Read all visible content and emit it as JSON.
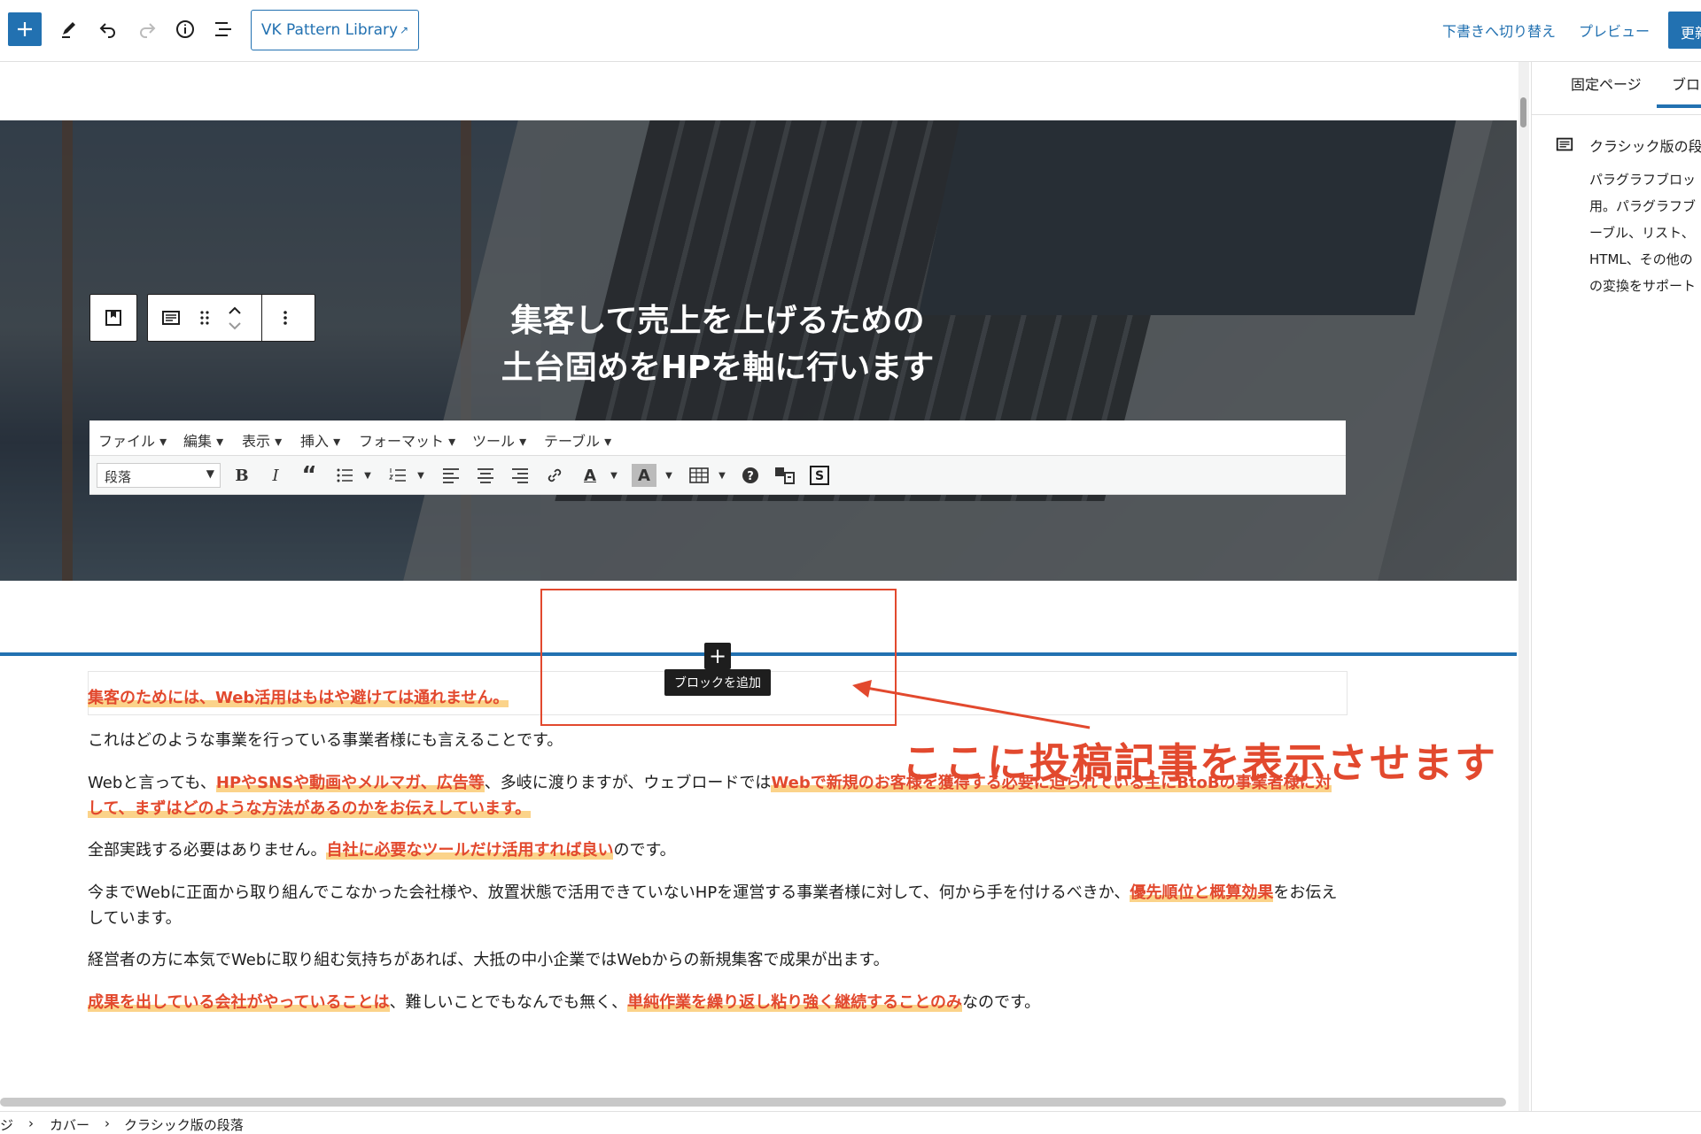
{
  "toolbar": {
    "vk_pattern_label": "VK Pattern Library",
    "draft_label": "下書きへ切り替え",
    "preview_label": "プレビュー",
    "update_label": "更新"
  },
  "sidebar": {
    "tab_page": "固定ページ",
    "tab_block": "ブロック",
    "block_title": "クラシック版の段落",
    "desc_lines": [
      "パラグラフブロッ",
      "用。パラグラフブ",
      "ーブル、リスト、",
      "HTML、その他の",
      "の変換をサポート"
    ]
  },
  "cover": {
    "title_line1": "集客して売上を上げるための",
    "title_line2": "土台固めをHPを軸に行います"
  },
  "classic": {
    "menus": [
      "ファイル ▾",
      "編集 ▾",
      "表示 ▾",
      "挿入 ▾",
      "フォーマット ▾",
      "ツール ▾",
      "テーブル ▾"
    ],
    "format_select": "段落"
  },
  "add_block_tooltip": "ブロックを追加",
  "annotation": "ここに投稿記事を表示させます",
  "content": {
    "p1": "集客のためには、Web活用はもはや避けては通れません。",
    "p2": "これはどのような事業を行っている事業者様にも言えることです。",
    "p3_a": "Webと言っても、",
    "p3_hl1": "HPやSNSや動画やメルマガ、広告等",
    "p3_b": "、多岐に渡りますが、ウェブロードでは",
    "p3_hl2": "Webで新規のお客様を獲得する必要に迫られている主にBtoBの事業者様に対して、まずはどのような方法があるのかをお伝えしています。",
    "p4_a": "全部実践する必要はありません。",
    "p4_hl": "自社に必要なツールだけ活用すれば良い",
    "p4_b": "のです。",
    "p5_a": "今までWebに正面から取り組んでこなかった会社様や、放置状態で活用できていないHPを運営する事業者様に対して、何から手を付けるべきか、",
    "p5_hl": "優先順位と概算効果",
    "p5_b": "をお伝えしています。",
    "p6": "経営者の方に本気でWebに取り組む気持ちがあれば、大抵の中小企業ではWebからの新規集客で成果が出ます。",
    "p7_hl1": "成果を出している会社がやっていることは",
    "p7_a": "、難しいことでもなんでも無く、",
    "p7_hl2": "単純作業を繰り返し粘り強く継続することのみ",
    "p7_b": "なのです。"
  },
  "breadcrumb": [
    "ジ",
    "›",
    "カバー",
    "›",
    "クラシック版の段落"
  ]
}
